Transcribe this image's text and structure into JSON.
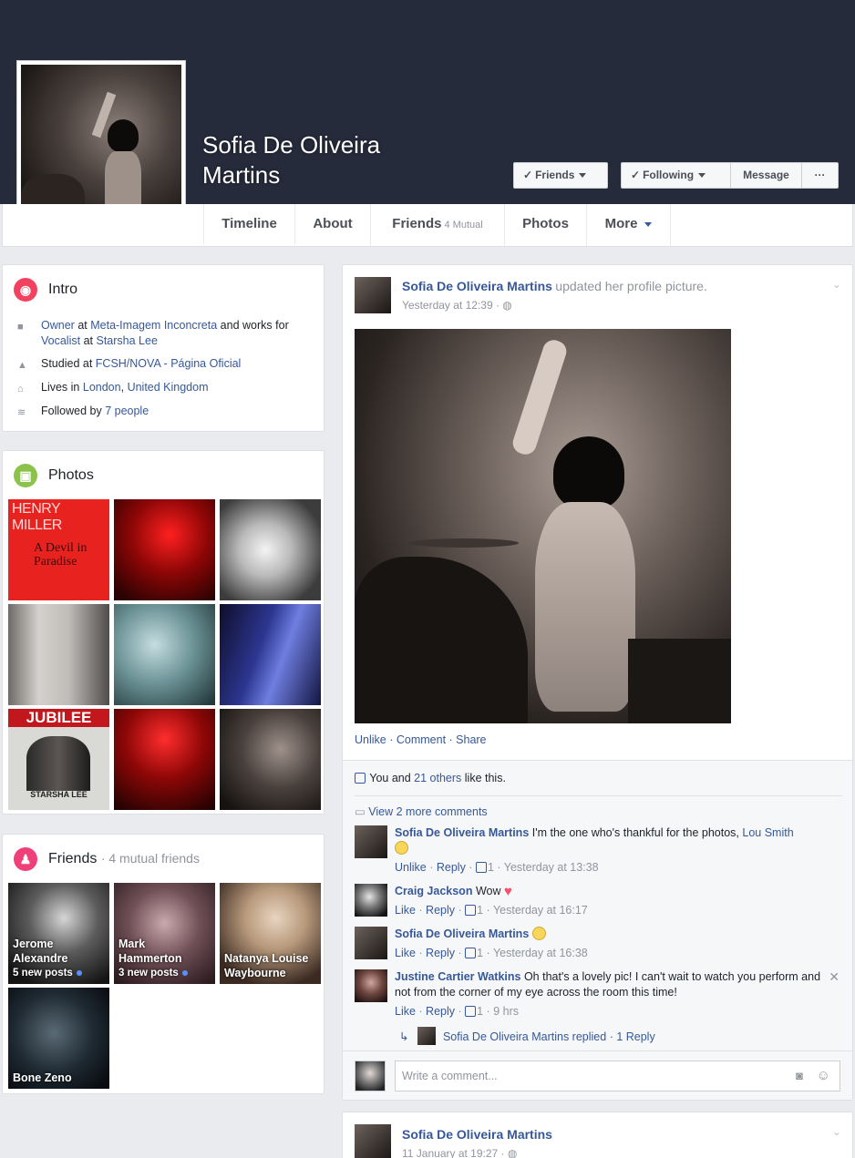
{
  "profile": {
    "name": "Sofia De Oliveira Martins"
  },
  "header_buttons": {
    "friends": "Friends",
    "following": "Following",
    "message": "Message",
    "more": "···"
  },
  "tabs": [
    {
      "label": "Timeline",
      "sub": ""
    },
    {
      "label": "About",
      "sub": ""
    },
    {
      "label": "Friends",
      "sub": "4 Mutual"
    },
    {
      "label": "Photos",
      "sub": ""
    },
    {
      "label": "More",
      "sub": ""
    }
  ],
  "intro": {
    "title": "Intro",
    "work1_role": "Owner",
    "work1_at": "at",
    "work1_place": "Meta-Imagem Inconcreta",
    "work_and": "and works",
    "work_for": "for",
    "work2_role": "Vocalist",
    "work2_at": "at",
    "work2_place": "Starsha Lee",
    "studied_pre": "Studied at",
    "studied_place": "FCSH/NOVA - Página Oficial",
    "lives_pre": "Lives in",
    "lives_city": "London",
    "lives_sep": ",",
    "lives_country": "United Kingdom",
    "followed_pre": "Followed by",
    "followed_count": "7 people"
  },
  "photos_card": {
    "title": "Photos",
    "album1_title": "HENRY MILLER",
    "album1_sub": "A Devil in Paradise",
    "album7_title": "JUBILEE",
    "album7_sub": "STARSHA LEE"
  },
  "friends_card": {
    "title": "Friends",
    "subtitle": "· 4 mutual friends",
    "friends": [
      {
        "name": "Jerome Alexandre",
        "posts": "5 new posts"
      },
      {
        "name": "Mark Hammerton",
        "posts": "3 new posts"
      },
      {
        "name": "Natanya Louise Waybourne",
        "posts": ""
      },
      {
        "name": "Bone Zeno",
        "posts": ""
      }
    ]
  },
  "post": {
    "author": "Sofia De Oliveira Martins",
    "action": "updated her profile picture.",
    "time": "Yesterday at 12:39 · ",
    "actions": [
      "Unlike",
      "Comment",
      "Share"
    ],
    "likes_you": "You and",
    "likes_others": "21 others",
    "likes_suffix": "like this.",
    "view_more": "View 2 more comments",
    "comments": [
      {
        "name": "Sofia De Oliveira Martins",
        "text": "I'm the one who's thankful for the photos,",
        "mention": "Lou Smith",
        "like_label": "Unlike",
        "reply": "Reply",
        "count": "1",
        "time": "Yesterday at 13:38"
      },
      {
        "name": "Craig Jackson",
        "text": "Wow",
        "like_label": "Like",
        "reply": "Reply",
        "count": "1",
        "time": "Yesterday at 16:17"
      },
      {
        "name": "Sofia De Oliveira Martins",
        "text": "",
        "like_label": "Like",
        "reply": "Reply",
        "count": "1",
        "time": "Yesterday at 16:38"
      },
      {
        "name": "Justine Cartier Watkins",
        "text": "Oh that's a lovely pic! I can't wait to watch you perform and not from the corner of my eye across the room this time!",
        "like_label": "Like",
        "reply": "Reply",
        "count": "1",
        "time": "9 hrs"
      }
    ],
    "reply_summary_name": "Sofia De Oliveira Martins replied",
    "reply_summary_count": "1 Reply",
    "comment_placeholder": "Write a comment..."
  },
  "post2": {
    "author": "Sofia De Oliveira Martins",
    "time": "11 January at 19:27 · "
  },
  "colors": {
    "cover": "#262b3b",
    "link": "#365899",
    "intro_icon": "#f3425f",
    "photos_icon": "#8bc34a",
    "friends_icon": "#f0407a"
  },
  "icons": [
    "globe-icon",
    "briefcase-icon",
    "graduation-icon",
    "house-icon",
    "rss-icon",
    "photo-icon",
    "people-icon",
    "thumb-icon",
    "comment-icon",
    "reply-arrow-icon",
    "camera-icon",
    "smiley-icon",
    "close-icon",
    "chevron-down-icon"
  ]
}
